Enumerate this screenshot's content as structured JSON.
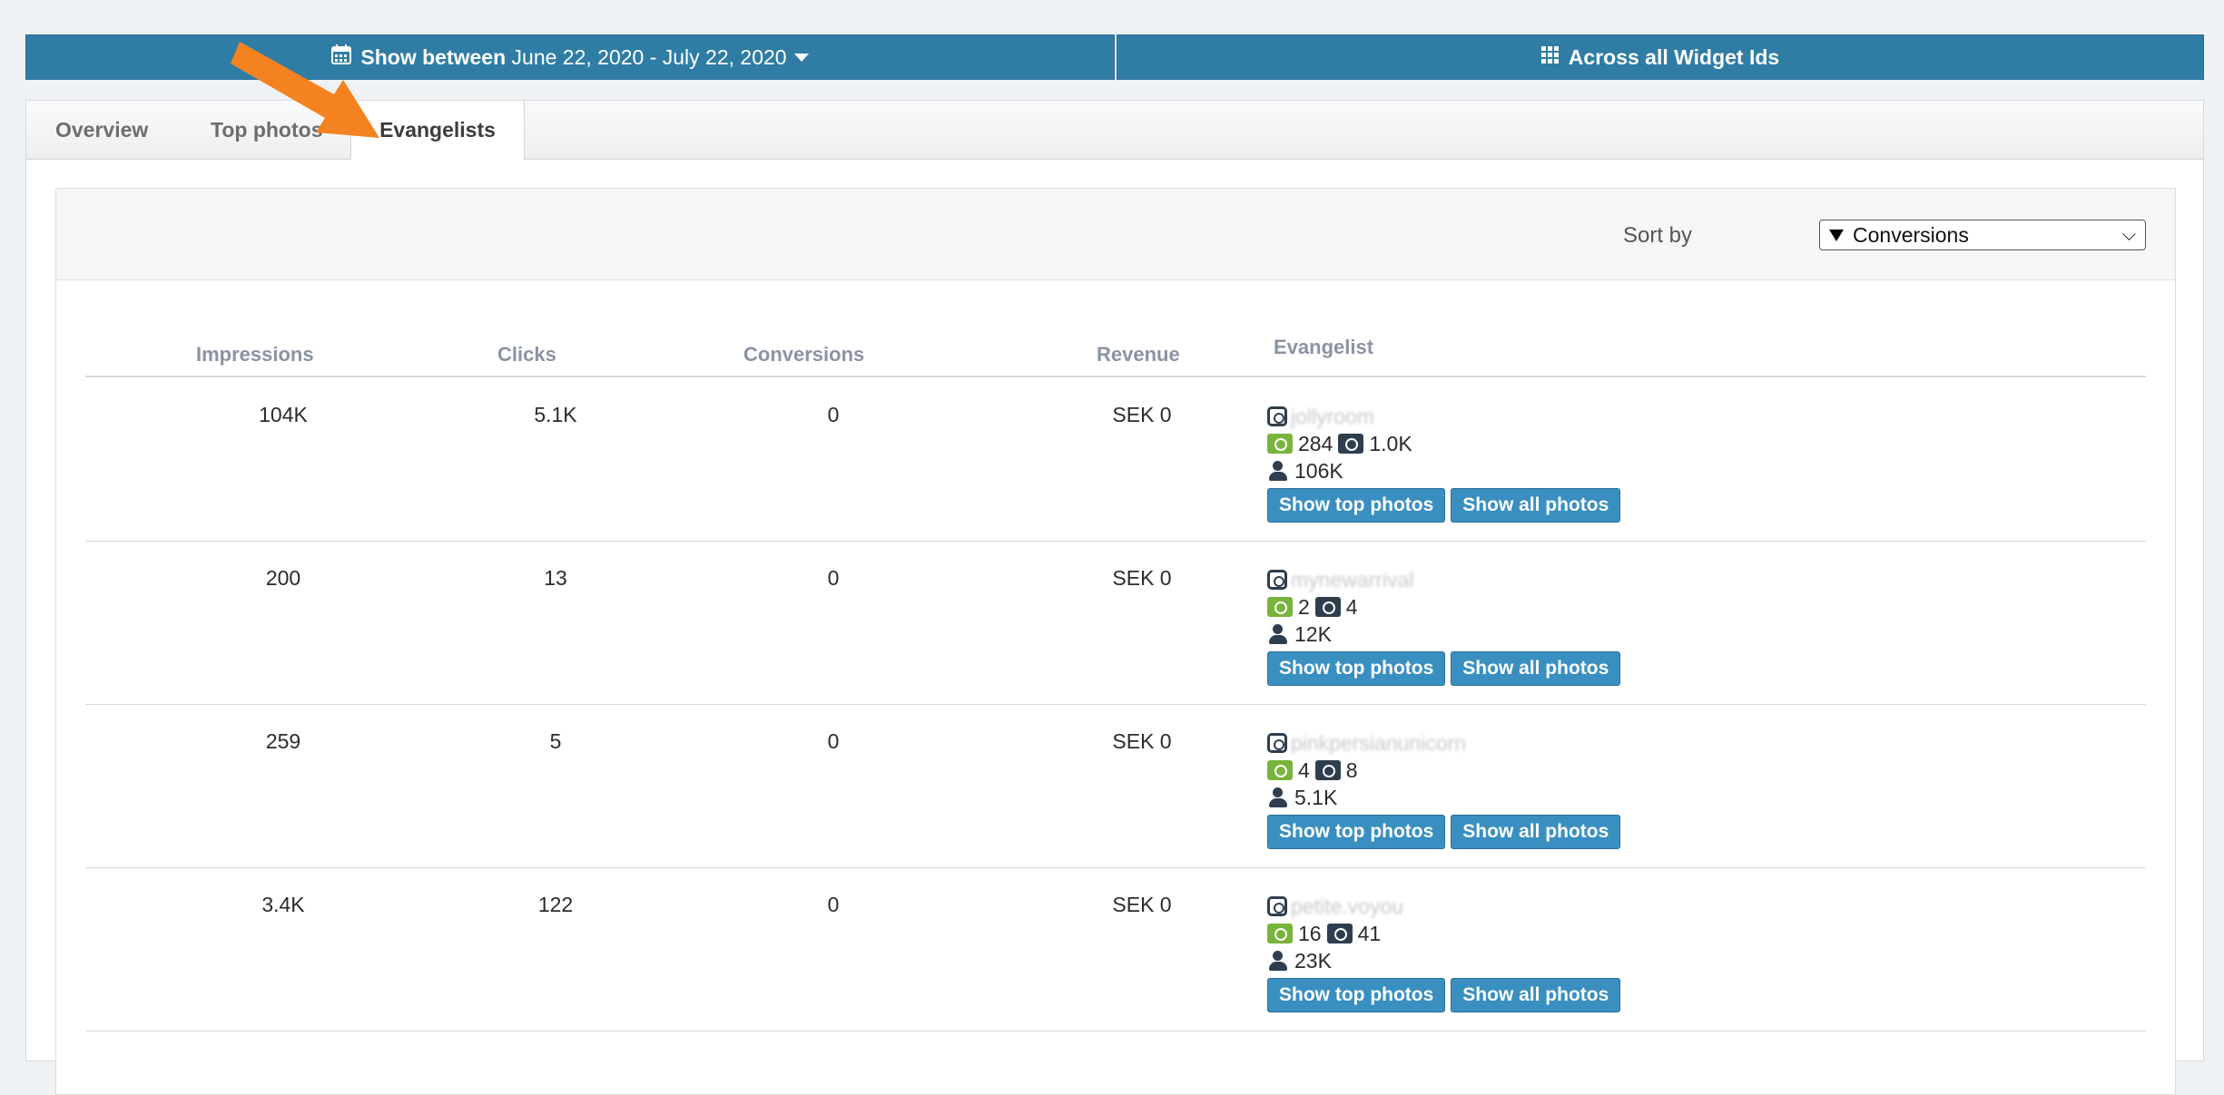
{
  "filters": {
    "date_prefix": "Show between",
    "date_range": "June 22, 2020 - July 22, 2020",
    "widget_label": "Across all Widget Ids"
  },
  "tabs": [
    {
      "label": "Overview"
    },
    {
      "label": "Top photos"
    },
    {
      "label": "Evangelists"
    }
  ],
  "sort": {
    "label": "Sort by",
    "value": "Conversions"
  },
  "columns": [
    "Impressions",
    "Clicks",
    "Conversions",
    "Revenue",
    "Evangelist"
  ],
  "rows": [
    {
      "impressions": "104K",
      "clicks": "5.1K",
      "conversions": "0",
      "revenue": "SEK 0",
      "handle": "jollyroom",
      "photos_green": "284",
      "photos_dark": "1.0K",
      "followers": "106K"
    },
    {
      "impressions": "200",
      "clicks": "13",
      "conversions": "0",
      "revenue": "SEK 0",
      "handle": "mynewarrival",
      "photos_green": "2",
      "photos_dark": "4",
      "followers": "12K"
    },
    {
      "impressions": "259",
      "clicks": "5",
      "conversions": "0",
      "revenue": "SEK 0",
      "handle": "pinkpersianunicorn",
      "photos_green": "4",
      "photos_dark": "8",
      "followers": "5.1K"
    },
    {
      "impressions": "3.4K",
      "clicks": "122",
      "conversions": "0",
      "revenue": "SEK 0",
      "handle": "petite.voyou",
      "photos_green": "16",
      "photos_dark": "41",
      "followers": "23K"
    }
  ],
  "buttons": {
    "top": "Show top photos",
    "all": "Show all photos"
  },
  "colors": {
    "bar": "#2f7da5",
    "button": "#3a8fc1",
    "arrow": "#f58220",
    "green": "#78b43c"
  }
}
